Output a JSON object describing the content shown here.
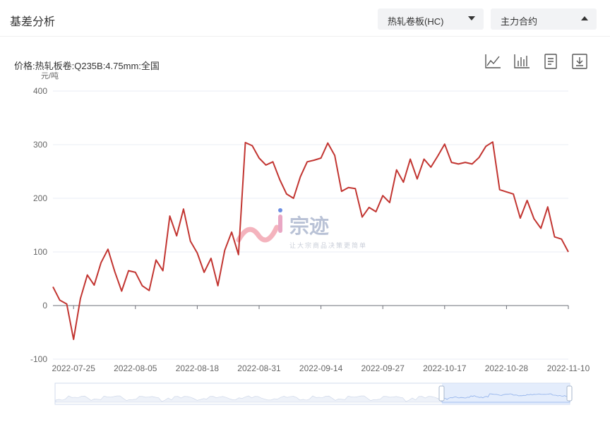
{
  "header": {
    "title": "基差分析",
    "product_select": "热轧卷板(HC)",
    "contract_select": "主力合约"
  },
  "chart_header": {
    "subtitle": "价格:热轧板卷:Q235B:4.75mm:全国",
    "unit": "元/吨"
  },
  "toolbar": {
    "icons": [
      "line-chart-icon",
      "bar-chart-icon",
      "data-view-icon",
      "download-icon"
    ]
  },
  "watermark": {
    "brand": "宗迹",
    "slogan": "让大宗商品决策更简单"
  },
  "colors": {
    "series": "#c23531",
    "grid": "#e8ecf5",
    "axis": "#6e7079",
    "slider_fill": "#d6e3fb",
    "slider_border": "#d2dbee"
  },
  "chart_data": {
    "type": "line",
    "title": "价格:热轧板卷:Q235B:4.75mm:全国",
    "ylabel": "元/吨",
    "ylim": [
      -100,
      400
    ],
    "yticks": [
      -100,
      0,
      100,
      200,
      300,
      400
    ],
    "grid": true,
    "xtick_labels": [
      "2022-07-25",
      "2022-08-05",
      "2022-08-18",
      "2022-08-31",
      "2022-09-14",
      "2022-09-27",
      "2022-10-17",
      "2022-10-28",
      "2022-11-10"
    ],
    "xtick_indices": [
      3,
      12,
      21,
      30,
      39,
      48,
      57,
      66,
      75
    ],
    "series": [
      {
        "values": [
          35,
          10,
          3,
          -63,
          13,
          57,
          38,
          80,
          105,
          63,
          27,
          65,
          62,
          37,
          28,
          85,
          65,
          167,
          130,
          180,
          120,
          98,
          62,
          88,
          37,
          103,
          137,
          95,
          304,
          298,
          275,
          262,
          268,
          235,
          208,
          200,
          240,
          268,
          271,
          275,
          303,
          280,
          213,
          220,
          218,
          165,
          183,
          175,
          205,
          192,
          253,
          230,
          273,
          236,
          273,
          258,
          279,
          301,
          267,
          264,
          267,
          264,
          276,
          297,
          305,
          216,
          212,
          208,
          163,
          196,
          162,
          144,
          184,
          128,
          124,
          100
        ]
      }
    ]
  }
}
